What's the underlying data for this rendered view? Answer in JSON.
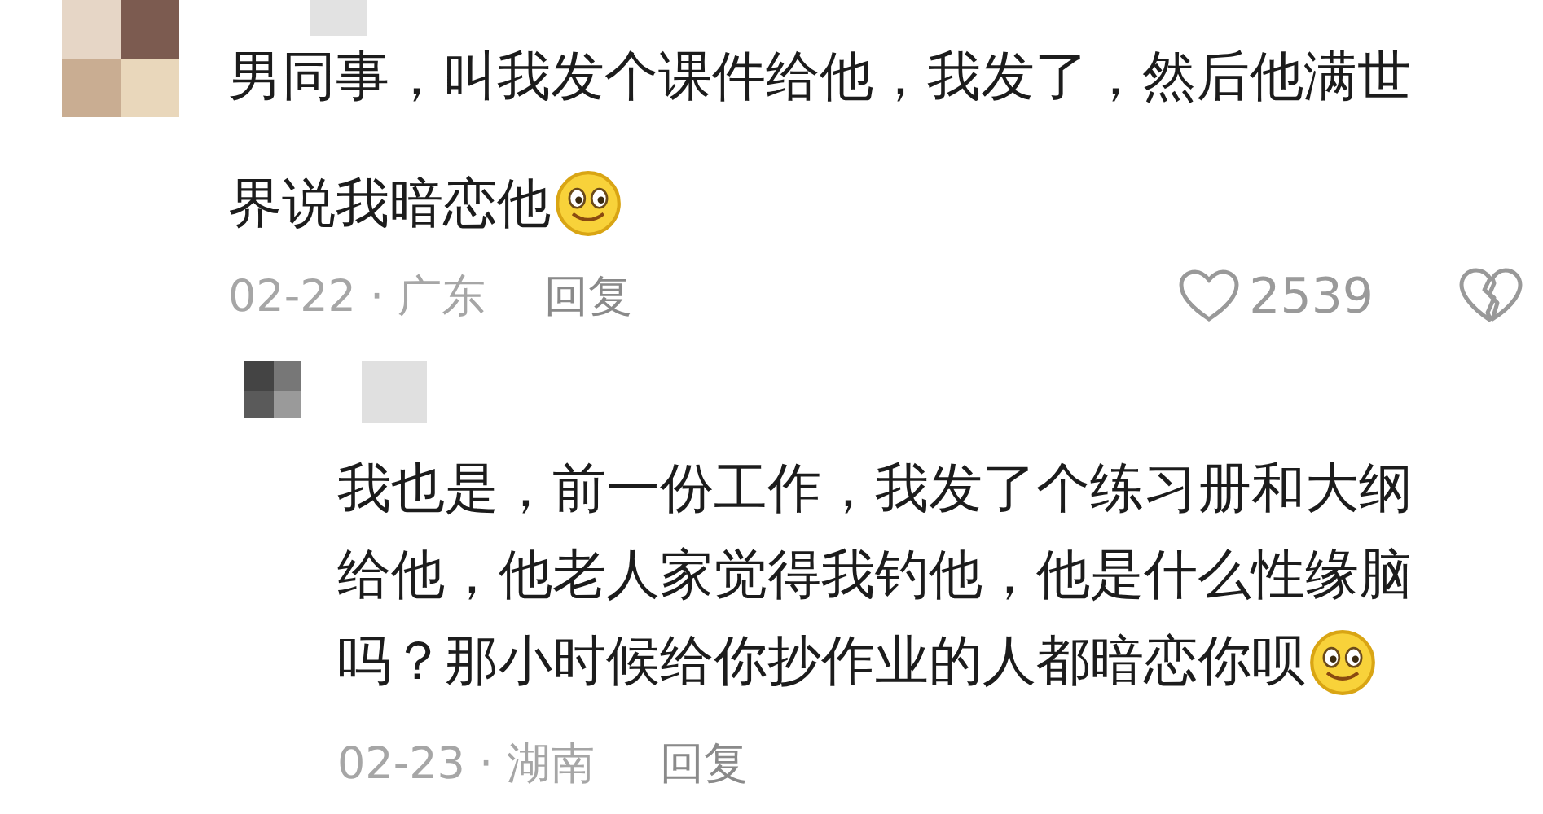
{
  "comment": {
    "text_lines": [
      "男同事，叫我发个课件给他，我发了，然后他满世",
      "界说我暗恋他"
    ],
    "meta": "02-22 · 广东",
    "reply_label": "回复",
    "likes": "2539"
  },
  "reply": {
    "text_lines": [
      "我也是，前一份工作，我发了个练习册和大纲",
      "给他，他老人家觉得我钓他，他是什么性缘脑",
      "吗？那小时候给你抄作业的人都暗恋你呗"
    ],
    "meta": "02-23 · 湖南",
    "reply_label": "回复"
  }
}
